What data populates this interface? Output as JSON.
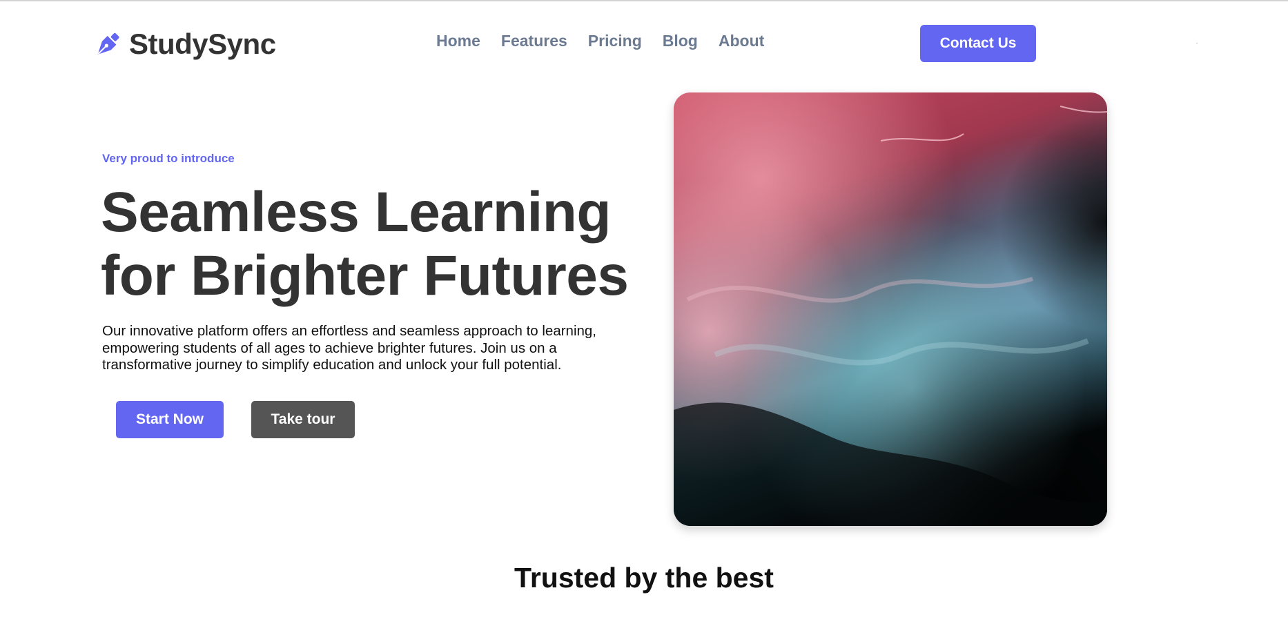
{
  "brand": {
    "name": "StudySync",
    "icon": "pen-nib-icon"
  },
  "nav": {
    "items": [
      "Home",
      "Features",
      "Pricing",
      "Blog",
      "About"
    ]
  },
  "header": {
    "contact_label": "Contact Us"
  },
  "hero": {
    "eyebrow": "Very proud to introduce",
    "title_line1": "Seamless Learning",
    "title_line2": "for Brighter Futures",
    "description": "Our innovative platform offers an effortless and seamless approach to learning, empowering students of all ages to achieve brighter futures. Join us on a transformative journey to simplify education and unlock your full potential.",
    "primary_button": "Start Now",
    "secondary_button": "Take tour"
  },
  "trusted": {
    "heading": "Trusted by the best"
  },
  "colors": {
    "accent": "#6366f1",
    "heading": "#333333",
    "nav_text": "#6b7a90",
    "secondary_button": "#555555"
  }
}
